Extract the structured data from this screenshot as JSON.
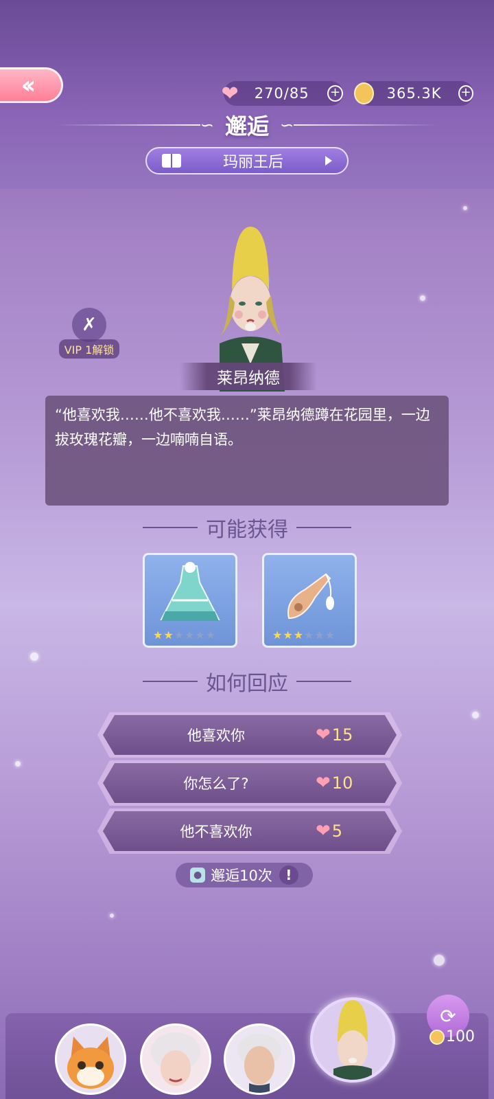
{
  "header": {
    "back_icon": "double-chevron-left-icon",
    "resources": {
      "stamina": {
        "icon": "heart-icon",
        "value": "270/85"
      },
      "coins": {
        "icon": "coin-icon",
        "value": "365.3K"
      }
    },
    "title": "邂逅",
    "chapter": {
      "icon": "book-icon",
      "label": "玛丽王后"
    }
  },
  "lock": {
    "icon": "locked-skip-icon",
    "label": "VIP 1解锁"
  },
  "character": {
    "name": "莱昂纳德"
  },
  "dialog": {
    "text": "“他喜欢我……他不喜欢我……”莱昂纳德蹲在花园里，一边拔玫瑰花瓣，一边喃喃自语。"
  },
  "rewards": {
    "heading": "可能获得",
    "items": [
      {
        "icon": "teal-dress-icon",
        "stars": 2,
        "max_stars": 6
      },
      {
        "icon": "lute-accessory-icon",
        "stars": 3,
        "max_stars": 5
      }
    ]
  },
  "responses": {
    "heading": "如何回应",
    "options": [
      {
        "label": "他喜欢你",
        "cost": "15"
      },
      {
        "label": "你怎么了?",
        "cost": "10"
      },
      {
        "label": "他不喜欢你",
        "cost": "5"
      }
    ]
  },
  "encounter_tag": {
    "label": "邂逅10次",
    "info": "!"
  },
  "bottom_bar": {
    "avatars": [
      "cat-avatar",
      "old-lady-avatar",
      "gentleman-avatar",
      "leonard-avatar"
    ],
    "swap": {
      "icon": "refresh-icon",
      "cost": "100"
    }
  },
  "colors": {
    "accent_pink": "#ff7f98",
    "purple_dark": "#6a5590",
    "cost_yellow": "#ffe28a"
  }
}
